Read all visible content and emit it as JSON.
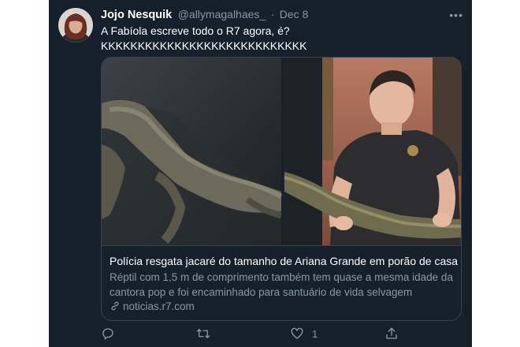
{
  "tweet": {
    "author_name": "Jojo Nesquik",
    "handle": "@allymagalhaes_",
    "separator": "·",
    "date": "Dec 8",
    "more_label": "•••",
    "text_lines": [
      "A Fabíola escreve todo o R7 agora, é?",
      "KKKKKKKKKKKKKKKKKKKKKKKKKKKK"
    ]
  },
  "card": {
    "title": "Polícia resgata jacaré do tamanho de Ariana Grande em porão de casa",
    "description_lines": [
      "Réptil com 1,5 m de comprimento também tem quase a mesma idade da",
      "cantora pop e foi encaminhado para santuário de vida selvagem"
    ],
    "domain": "noticias.r7.com",
    "domain_icon": "link-icon"
  },
  "actions": {
    "reply_count": "",
    "retweet_count": "",
    "like_count": "1",
    "icons": [
      "reply-icon",
      "retweet-icon",
      "like-icon",
      "share-icon"
    ]
  },
  "colors": {
    "background": "#15202b",
    "text": "#ffffff",
    "secondary": "#8899a6",
    "border": "#38444d"
  }
}
